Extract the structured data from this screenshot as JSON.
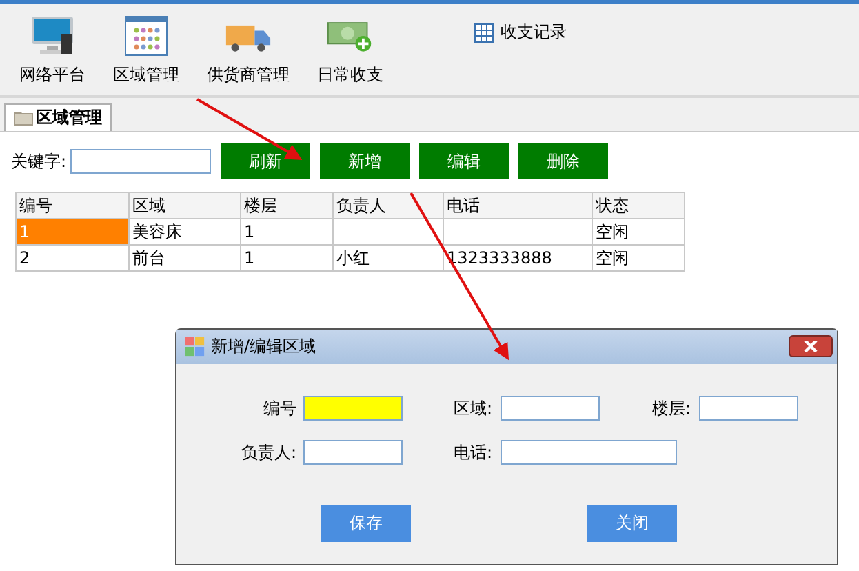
{
  "toolbar": {
    "items": [
      {
        "label": "网络平台",
        "kind": "monitor"
      },
      {
        "label": "区域管理",
        "kind": "calendar"
      },
      {
        "label": "供货商管理",
        "kind": "truck"
      },
      {
        "label": "日常收支",
        "kind": "money"
      }
    ],
    "link": "收支记录"
  },
  "tabs": [
    {
      "label": "区域管理",
      "selected": true
    }
  ],
  "search": {
    "label": "关键字:"
  },
  "buttons": [
    "刷新",
    "新增",
    "编辑",
    "删除"
  ],
  "table": {
    "columns": [
      "编号",
      "区域",
      "楼层",
      "负责人",
      "电话",
      "状态"
    ],
    "rows": [
      {
        "selected": true,
        "cells": [
          "1",
          "美容床",
          "1",
          "",
          "",
          "空闲"
        ]
      },
      {
        "selected": false,
        "cells": [
          "2",
          "前台",
          "1",
          "小红",
          "1323333888",
          "空闲"
        ]
      }
    ]
  },
  "dialog": {
    "title": "新增/编辑区域",
    "rows": [
      [
        {
          "label": "编号",
          "highlighted": true,
          "wide": false
        },
        {
          "label": "区域:",
          "highlighted": false,
          "wide": false
        },
        {
          "label": "楼层:",
          "highlighted": false,
          "wide": false
        }
      ],
      [
        {
          "label": "负责人:",
          "highlighted": false,
          "wide": false
        },
        {
          "label": "电话:",
          "highlighted": false,
          "wide": true
        }
      ]
    ],
    "buttons": [
      "保存",
      "关闭"
    ]
  }
}
